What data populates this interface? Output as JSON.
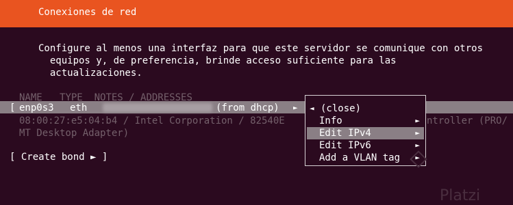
{
  "header": {
    "title": "Conexiones de red"
  },
  "intro": {
    "lines": [
      "Configure al menos una interfaz para que este servidor se comunique con otros",
      "equipos y, de preferencia, brinde acceso suficiente para las",
      "actualizaciones."
    ]
  },
  "table": {
    "columns": [
      "NAME",
      "TYPE",
      "NOTES / ADDRESSES"
    ],
    "row": {
      "bracket": "[",
      "name": "enp0s3",
      "type": "eth",
      "address_note": "(from dhcp)",
      "arrow": "►"
    },
    "details": [
      "08:00:27:e5:04:b4 / Intel Corporation / 82540E",
      "MT Desktop Adapter)"
    ],
    "details_tail": "ntroller (PRO/"
  },
  "create_bond": "[ Create bond ► ]",
  "menu": {
    "items": [
      {
        "label": "(close)",
        "arrow": "◄"
      },
      {
        "label": "Info",
        "arrow": "►"
      },
      {
        "label": "Edit IPv4",
        "arrow": "►",
        "active": true
      },
      {
        "label": "Edit IPv6",
        "arrow": "►"
      },
      {
        "label": "Add a VLAN tag",
        "arrow": "►"
      }
    ]
  },
  "watermark": "Platzi",
  "colors": {
    "header": "#e95420",
    "background": "#2b0a1f",
    "highlight": "#8a7f85",
    "muted_text": "#74606b"
  }
}
